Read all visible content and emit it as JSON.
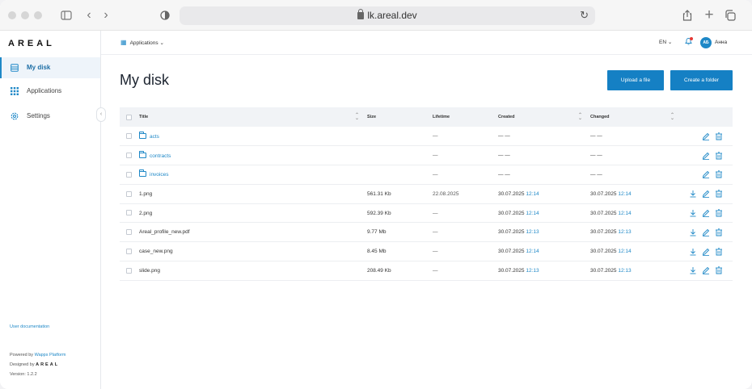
{
  "browser": {
    "url": "lk.areal.dev"
  },
  "sidebar": {
    "logo": "AREAL",
    "items": [
      {
        "label": "My disk",
        "icon": "disk-icon",
        "active": true
      },
      {
        "label": "Applications",
        "icon": "grid-icon",
        "active": false
      },
      {
        "label": "Settings",
        "icon": "gear-icon",
        "active": false
      }
    ],
    "user_doc": "User documentation",
    "powered_by": "Powered by",
    "powered_brand": "Wapps Platform",
    "designed_by": "Designed by",
    "designed_logo": "AREAL",
    "version": "Version: 1.2.2"
  },
  "topbar": {
    "apps_label": "Applications",
    "lang": "EN",
    "avatar_initials": "АБ",
    "user_name": "Анна"
  },
  "main": {
    "title": "My disk",
    "upload_label": "Upload a file",
    "create_folder_label": "Create a folder",
    "columns": {
      "title": "Title",
      "size": "Size",
      "lifetime": "Lifetime",
      "created": "Created",
      "changed": "Changed"
    },
    "rows": [
      {
        "name": "acts",
        "folder": true,
        "size": "",
        "lifetime": "—",
        "created_date": "— —",
        "created_time": "",
        "changed_date": "— —",
        "changed_time": "",
        "download": false
      },
      {
        "name": "contracts",
        "folder": true,
        "size": "",
        "lifetime": "—",
        "created_date": "— —",
        "created_time": "",
        "changed_date": "— —",
        "changed_time": "",
        "download": false
      },
      {
        "name": "invoices",
        "folder": true,
        "size": "",
        "lifetime": "—",
        "created_date": "— —",
        "created_time": "",
        "changed_date": "— —",
        "changed_time": "",
        "download": false
      },
      {
        "name": "1.png",
        "folder": false,
        "size": "561.31 Kb",
        "lifetime": "22.08.2025",
        "created_date": "30.07.2025",
        "created_time": "12:14",
        "changed_date": "30.07.2025",
        "changed_time": "12:14",
        "download": true
      },
      {
        "name": "2.png",
        "folder": false,
        "size": "592.39 Kb",
        "lifetime": "—",
        "created_date": "30.07.2025",
        "created_time": "12:14",
        "changed_date": "30.07.2025",
        "changed_time": "12:14",
        "download": true
      },
      {
        "name": "Areal_profile_new.pdf",
        "folder": false,
        "size": "9.77 Mb",
        "lifetime": "—",
        "created_date": "30.07.2025",
        "created_time": "12:13",
        "changed_date": "30.07.2025",
        "changed_time": "12:13",
        "download": true
      },
      {
        "name": "case_new.png",
        "folder": false,
        "size": "8.45 Mb",
        "lifetime": "—",
        "created_date": "30.07.2025",
        "created_time": "12:14",
        "changed_date": "30.07.2025",
        "changed_time": "12:14",
        "download": true
      },
      {
        "name": "slide.png",
        "folder": false,
        "size": "208.49 Kb",
        "lifetime": "—",
        "created_date": "30.07.2025",
        "created_time": "12:13",
        "changed_date": "30.07.2025",
        "changed_time": "12:13",
        "download": true
      }
    ]
  },
  "colors": {
    "accent": "#1580c4",
    "link": "#1e88c7"
  }
}
